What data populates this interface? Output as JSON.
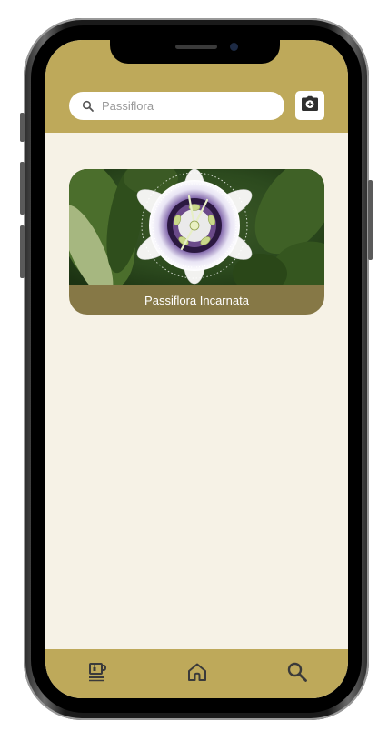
{
  "search": {
    "placeholder": "Passiflora",
    "icon": "search-icon"
  },
  "header": {
    "camera_button_icon": "camera-icon"
  },
  "cards": [
    {
      "title": "Passiflora Incarnata",
      "image": "passion-flower-photo"
    }
  ],
  "bottom_nav": [
    {
      "name": "tea",
      "icon": "tea-cup-icon"
    },
    {
      "name": "home",
      "icon": "home-icon"
    },
    {
      "name": "search",
      "icon": "search-icon"
    }
  ],
  "colors": {
    "accent": "#bea95a",
    "background": "#f6f2e6",
    "card_caption_bg": "#867846",
    "icon": "#3a3a3a"
  }
}
